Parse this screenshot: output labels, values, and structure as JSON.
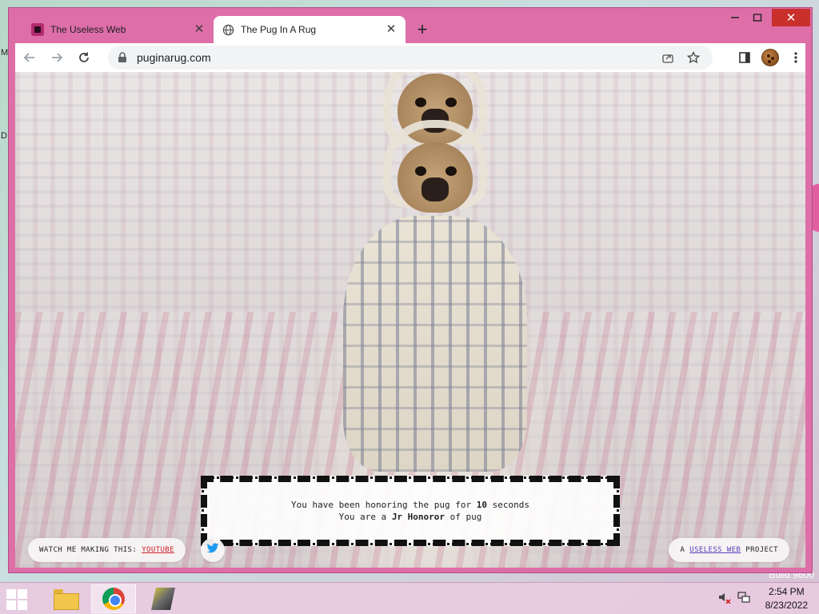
{
  "browser": {
    "tabs": [
      {
        "title": "The Useless Web",
        "active": false
      },
      {
        "title": "The Pug In A Rug",
        "active": true
      }
    ],
    "url": "puginarug.com"
  },
  "page": {
    "honor_line1_prefix": "You have been honoring the pug for ",
    "honor_seconds": "10",
    "honor_line1_suffix": " seconds",
    "honor_line2_prefix": "You are a ",
    "honor_rank": "Jr Honoror",
    "honor_line2_suffix": " of pug",
    "watch_label": "WATCH ME MAKING THIS:",
    "youtube_link": "YOUTUBE",
    "project_prefix": "A",
    "useless_web_link": "USELESS WEB",
    "project_suffix": "PROJECT"
  },
  "taskbar": {
    "time": "2:54 PM",
    "date": "8/23/2022"
  },
  "desktop": {
    "fragments": [
      "M",
      "D"
    ],
    "build_text": "Build 9600"
  },
  "colors": {
    "window_frame": "#de6ea8",
    "youtube_link": "#d0202b",
    "useless_web_link": "#5b3bbd",
    "close_button": "#c9302c"
  },
  "icons": {
    "tab_favicon_inactive": "useless-web-favicon",
    "tab_favicon_active": "globe-icon",
    "twitter": "twitter-bird-icon"
  }
}
